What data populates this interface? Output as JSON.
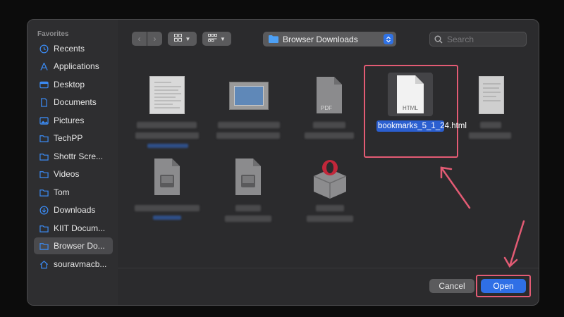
{
  "sidebar": {
    "section_title": "Favorites",
    "items": [
      {
        "label": "Recents",
        "icon": "clock-icon"
      },
      {
        "label": "Applications",
        "icon": "applications-icon"
      },
      {
        "label": "Desktop",
        "icon": "desktop-icon"
      },
      {
        "label": "Documents",
        "icon": "document-icon"
      },
      {
        "label": "Pictures",
        "icon": "pictures-icon"
      },
      {
        "label": "TechPP",
        "icon": "folder-icon"
      },
      {
        "label": "Shottr Scre...",
        "icon": "folder-icon"
      },
      {
        "label": "Videos",
        "icon": "folder-icon"
      },
      {
        "label": "Tom",
        "icon": "folder-icon"
      },
      {
        "label": "Downloads",
        "icon": "download-icon"
      },
      {
        "label": "KIIT Docum...",
        "icon": "folder-icon"
      },
      {
        "label": "Browser Do...",
        "icon": "folder-icon",
        "selected": true
      },
      {
        "label": "souravmacb...",
        "icon": "home-icon"
      }
    ]
  },
  "toolbar": {
    "location_label": "Browser Downloads",
    "search_placeholder": "Search"
  },
  "files": {
    "pdf_label": "PDF",
    "html_label": "HTML",
    "selected_name": "bookmarks_5_1_24.html"
  },
  "footer": {
    "cancel_label": "Cancel",
    "open_label": "Open"
  },
  "colors": {
    "accent": "#2f6fe6",
    "highlight": "#e35b74"
  }
}
